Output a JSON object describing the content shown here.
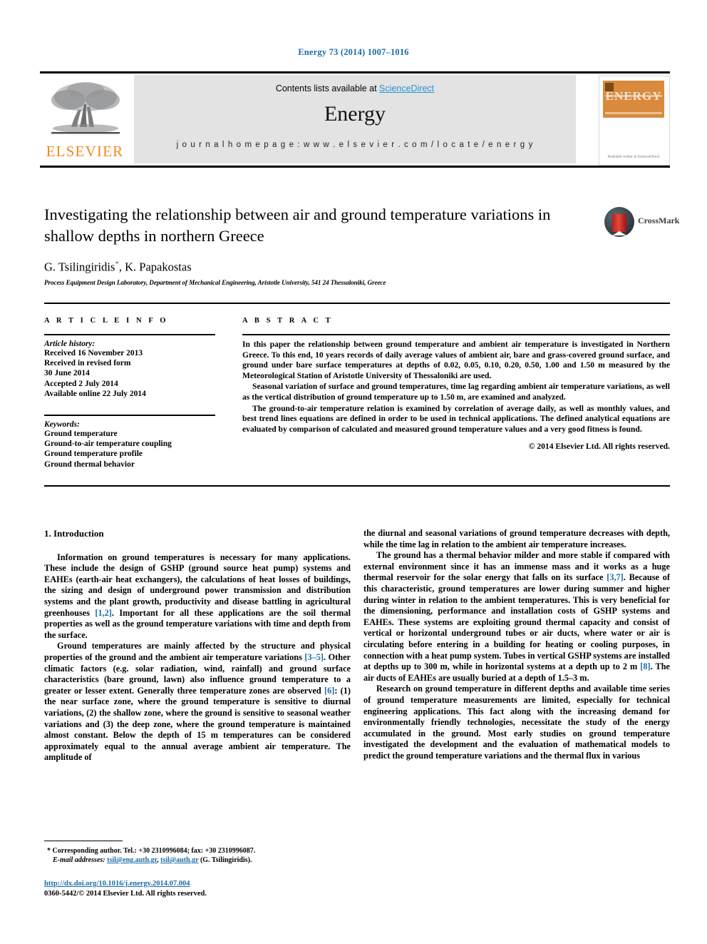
{
  "running_head": "Energy 73 (2014) 1007–1016",
  "masthead": {
    "contents_prefix": "Contents lists available at ",
    "sciencedirect": "ScienceDirect",
    "journal_name": "Energy",
    "homepage": "j o u r n a l   h o m e p a g e :   w w w . e l s e v i e r . c o m / l o c a t e / e n e r g y",
    "publisher_wordmark": "ELSEVIER",
    "cover_wordmark": "ENERGY",
    "cover_caption": "Available online at\nScienceDirect"
  },
  "title": "Investigating the relationship between air and ground temperature variations in shallow depths in northern Greece",
  "authors": "G. Tsilingiridis",
  "authors_marker": "*",
  "authors_rest": ", K. Papakostas",
  "affiliation": "Process Equipment Design Laboratory, Department of Mechanical Engineering, Aristotle University, 541 24 Thessaloniki, Greece",
  "crossmark_label": "CrossMark",
  "article_info": {
    "heading": "A R T I C L E   I N F O",
    "history_label": "Article history:",
    "history": [
      "Received 16 November 2013",
      "Received in revised form",
      "30 June 2014",
      "Accepted 2 July 2014",
      "Available online 22 July 2014"
    ],
    "keywords_label": "Keywords:",
    "keywords": [
      "Ground temperature",
      "Ground-to-air temperature coupling",
      "Ground temperature profile",
      "Ground thermal behavior"
    ]
  },
  "abstract": {
    "heading": "A B S T R A C T",
    "paragraphs": [
      "In this paper the relationship between ground temperature and ambient air temperature is investigated in Northern Greece. To this end, 10 years records of daily average values of ambient air, bare and grass-covered ground surface, and ground under bare surface temperatures at depths of 0.02, 0.05, 0.10, 0.20, 0.50, 1.00 and 1.50 m measured by the Meteorological Station of Aristotle University of Thessaloniki are used.",
      "Seasonal variation of surface and ground temperatures, time lag regarding ambient air temperature variations, as well as the vertical distribution of ground temperature up to 1.50 m, are examined and analyzed.",
      "The ground-to-air temperature relation is examined by correlation of average daily, as well as monthly values, and best trend lines equations are defined in order to be used in technical applications. The defined analytical equations are evaluated by comparison of calculated and measured ground temperature values and a very good fitness is found."
    ],
    "copyright": "© 2014 Elsevier Ltd. All rights reserved."
  },
  "body": {
    "section_number_title": "1.  Introduction",
    "left_paragraphs": [
      "Information on ground temperatures is necessary for many applications. These include the design of GSHP (ground source heat pump) systems and EAHEs (earth-air heat exchangers), the calculations of heat losses of buildings, the sizing and design of underground power transmission and distribution systems and the plant growth, productivity and disease battling in agricultural greenhouses [1,2]. Important for all these applications are the soil thermal properties as well as the ground temperature variations with time and depth from the surface.",
      "Ground temperatures are mainly affected by the structure and physical properties of the ground and the ambient air temperature variations [3–5]. Other climatic factors (e.g. solar radiation, wind, rainfall) and ground surface characteristics (bare ground, lawn) also influence ground temperature to a greater or lesser extent. Generally three temperature zones are observed [6]: (1) the near surface zone, where the ground temperature is sensitive to diurnal variations, (2) the shallow zone, where the ground is sensitive to seasonal weather variations and (3) the deep zone, where the ground temperature is maintained almost constant. Below the depth of 15 m temperatures can be considered approximately equal to the annual average ambient air temperature. The amplitude of"
    ],
    "right_paragraphs": [
      "the diurnal and seasonal variations of ground temperature decreases with depth, while the time lag in relation to the ambient air temperature increases.",
      "The ground has a thermal behavior milder and more stable if compared with external environment since it has an immense mass and it works as a huge thermal reservoir for the solar energy that falls on its surface [3,7]. Because of this characteristic, ground temperatures are lower during summer and higher during winter in relation to the ambient temperatures. This is very beneficial for the dimensioning, performance and installation costs of GSHP systems and EAHEs. These systems are exploiting ground thermal capacity and consist of vertical or horizontal underground tubes or air ducts, where water or air is circulating before entering in a building for heating or cooling purposes, in connection with a heat pump system. Tubes in vertical GSHP systems are installed at depths up to 300 m, while in horizontal systems at a depth up to 2 m [8]. The air ducts of EAHEs are usually buried at a depth of 1.5–3 m.",
      "Research on ground temperature in different depths and available time series of ground temperature measurements are limited, especially for technical engineering applications. This fact along with the increasing demand for environmentally friendly technologies, necessitate the study of the energy accumulated in the ground. Most early studies on ground temperature investigated the development and the evaluation of mathematical models to predict the ground temperature variations and the thermal flux in various"
    ],
    "references_inline": [
      "[1,2]",
      "[3–5]",
      "[6]",
      "[3,7]",
      "[8]"
    ]
  },
  "footnote": {
    "marker": "*",
    "corresponding": "Corresponding author. Tel.: +30 2310996084; fax: +30 2310996087.",
    "email_label": "E-mail addresses:",
    "email1": "tsil@eng.auth.gr",
    "email_sep": ", ",
    "email2": "tsil@auth.gr",
    "email_tail": " (G. Tsilingiridis)."
  },
  "doi_block": {
    "doi": "http://dx.doi.org/10.1016/j.energy.2014.07.004",
    "issn_line": "0360-5442/© 2014 Elsevier Ltd. All rights reserved."
  },
  "colors": {
    "link": "#1b6ca8",
    "sciencedirect": "#2196d6",
    "elsevier_orange": "#f08a1e",
    "panel_grey": "#e3e3e3",
    "cover_orange": "#d98a3c"
  }
}
